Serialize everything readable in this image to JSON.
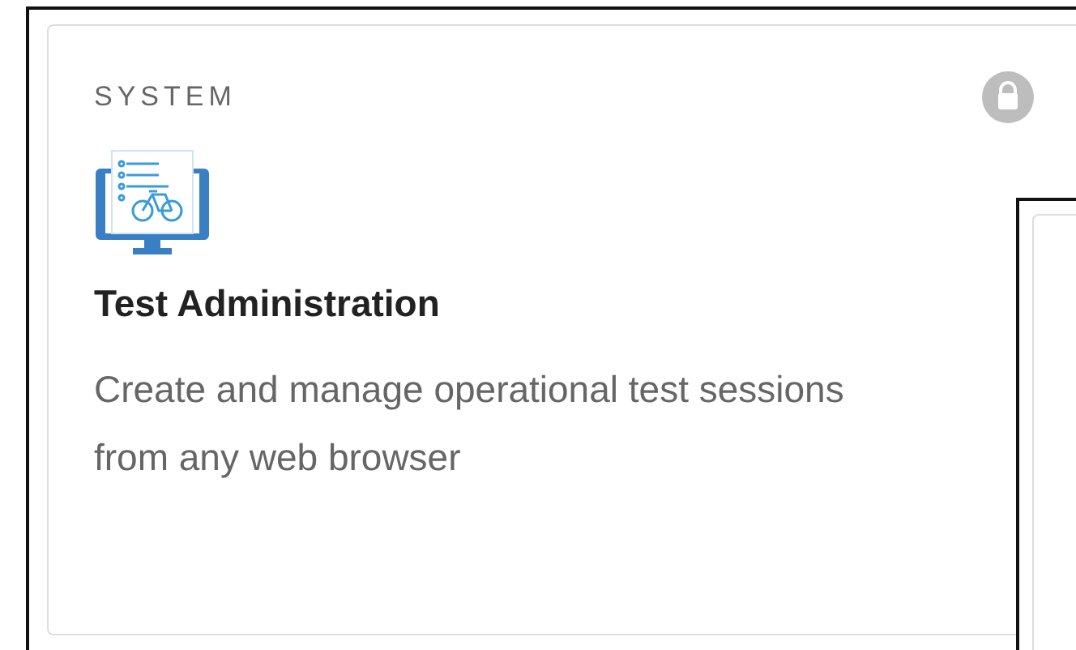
{
  "card": {
    "category": "SYSTEM",
    "locked": true,
    "title": "Test Administration",
    "description": "Create and manage operational test sessions from any web browser"
  }
}
